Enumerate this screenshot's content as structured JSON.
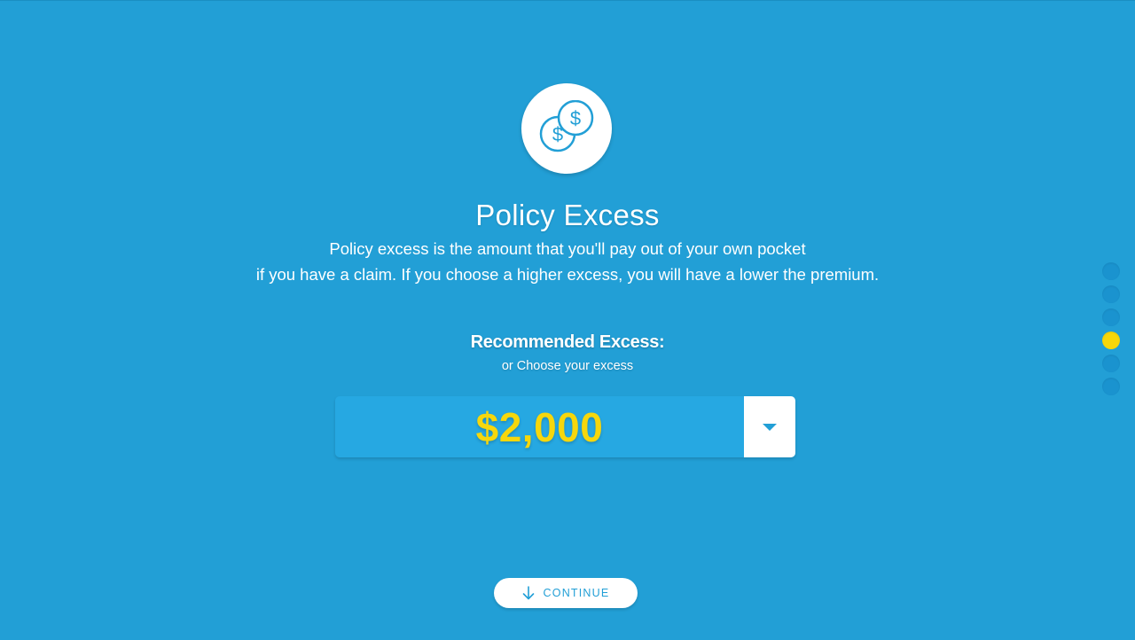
{
  "header": {
    "icon": "coins-dollar-icon",
    "title": "Policy Excess",
    "description_line1": "Policy excess is the amount that you'll pay out of your own pocket",
    "description_line2": "if you have a claim. If you choose a higher excess, you will have a lower the premium."
  },
  "excess": {
    "recommended_label": "Recommended Excess:",
    "choose_label": "or Choose your excess",
    "selected_value": "$2,000",
    "toggle_icon": "chevron-down-icon"
  },
  "steps": {
    "count": 6,
    "active_index": 3
  },
  "footer": {
    "continue_label": "CONTINUE",
    "continue_icon": "arrow-down-icon"
  },
  "colors": {
    "background": "#229fd6",
    "accent_yellow": "#f6d70c",
    "white": "#ffffff",
    "dot_inactive": "#1a93cf"
  }
}
